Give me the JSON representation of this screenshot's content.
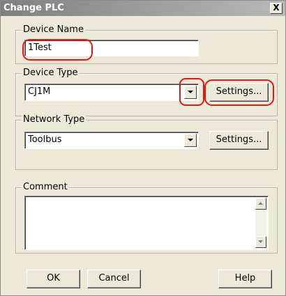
{
  "window": {
    "title": "Change PLC",
    "close_label": "X"
  },
  "device_name": {
    "legend": "Device Name",
    "value": "1Test"
  },
  "device_type": {
    "legend": "Device Type",
    "value": "CJ1M",
    "settings_label": "Settings..."
  },
  "network_type": {
    "legend": "Network Type",
    "value": "Toolbus",
    "settings_label": "Settings..."
  },
  "comment": {
    "legend": "Comment",
    "value": ""
  },
  "buttons": {
    "ok": "OK",
    "cancel": "Cancel",
    "help": "Help"
  },
  "colors": {
    "highlight": "#e01818",
    "dialog_bg": "#ece9d8"
  }
}
